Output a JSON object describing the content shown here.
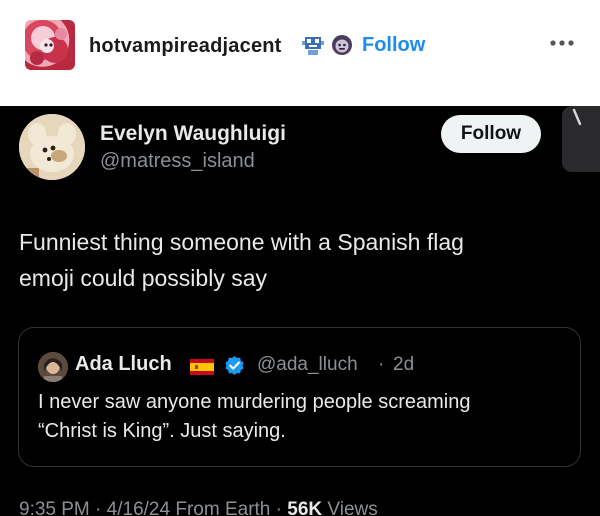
{
  "post": {
    "blog_name": "hotvampireadjacent",
    "follow_label": "Follow",
    "badges": [
      "pixel-robot-badge-icon",
      "gorilla-badge-icon"
    ],
    "more_icon": "more-dots-icon"
  },
  "tweet": {
    "author_name": "Evelyn Waughluigi",
    "author_handle": "@matress_island",
    "follow_label": "Follow",
    "text_lines": [
      "Funniest thing someone with a Spanish flag",
      "emoji could possibly say"
    ],
    "quote": {
      "author_name": "Ada Lluch",
      "author_handle": "@ada_lluch",
      "separator": "·",
      "age": "2d",
      "flag_icon": "spain-flag-icon",
      "verified_icon": "verified-badge-icon",
      "text_lines": [
        "I never saw anyone murdering people screaming",
        "“Christ is King”. Just saying."
      ]
    },
    "meta": {
      "time": "9:35 PM",
      "date": "4/16/24",
      "source": "From Earth",
      "views_count": "56K",
      "views_label": "Views"
    }
  },
  "colors": {
    "follow_blue": "#1b8cf0",
    "tweet_background": "#000000",
    "tweet_text": "#e7e9ea",
    "secondary_text": "#8b9096",
    "verified_blue": "#1d9bf0"
  }
}
